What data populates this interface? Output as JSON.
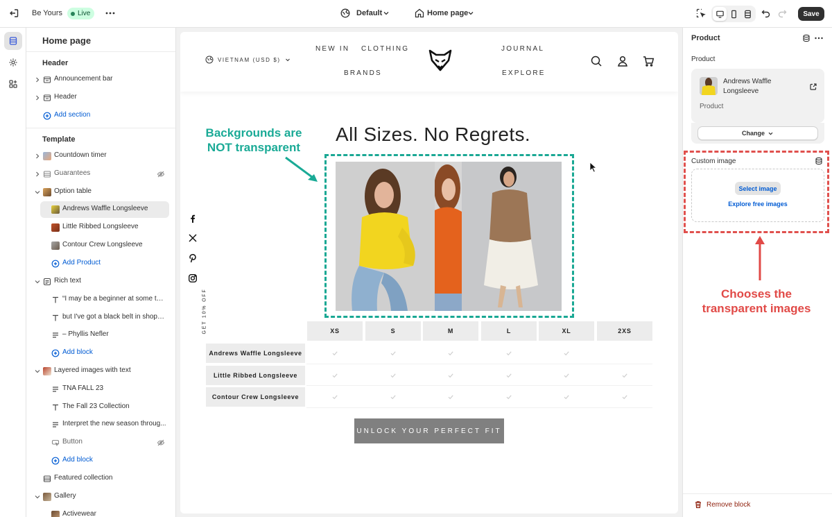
{
  "topbar": {
    "store_name": "Be Yours",
    "status": "Live",
    "theme_selector": "Default",
    "page_selector": "Home page",
    "save_label": "Save"
  },
  "left_panel": {
    "title": "Home page",
    "header_group": "Header",
    "header_items": [
      "Announcement bar",
      "Header"
    ],
    "add_section": "Add section",
    "template_group": "Template",
    "template_items": {
      "countdown": "Countdown timer",
      "guarantees": "Guarantees",
      "option_table": "Option table",
      "product_1": "Andrews Waffle Longsleeve",
      "product_2": "Little Ribbed Longsleeve",
      "product_3": "Contour Crew Longsleeve",
      "add_product": "Add Product",
      "rich_text": "Rich text",
      "rt_1": "“I may be a beginner at some thi...",
      "rt_2": "but I've got a black belt in shoppi...",
      "rt_3": "– Phyllis Nefler",
      "add_block_1": "Add block",
      "layered": "Layered images with text",
      "li_1": "TNA FALL 23",
      "li_2": "The Fall 23 Collection",
      "li_3": "Interpret the new season throug...",
      "li_4": "Button",
      "add_block_2": "Add block",
      "featured": "Featured collection",
      "gallery": "Gallery",
      "gallery_1": "Activewear"
    }
  },
  "storefront": {
    "locale": "VIETNAM (USD $)",
    "nav": [
      "NEW IN",
      "CLOTHING",
      "BRANDS",
      "JOURNAL",
      "EXPLORE"
    ],
    "section_title": "All Sizes. No Regrets.",
    "promo_vertical": "GET 10% OFF",
    "sizes": [
      "XS",
      "S",
      "M",
      "L",
      "XL",
      "2XS"
    ],
    "rows": [
      {
        "name": "Andrews Waffle Longsleeve",
        "checks": [
          1,
          1,
          1,
          1,
          1,
          0
        ]
      },
      {
        "name": "Little Ribbed Longsleeve",
        "checks": [
          1,
          1,
          1,
          1,
          1,
          1
        ]
      },
      {
        "name": "Contour Crew Longsleeve",
        "checks": [
          1,
          1,
          1,
          1,
          1,
          1
        ]
      }
    ],
    "cta": "UNLOCK YOUR PERFECT FIT"
  },
  "annotations": {
    "green_line1": "Backgrounds are",
    "green_line2": "NOT transparent",
    "red_line1": "Chooses the",
    "red_line2": "transparent images",
    "green_color": "#1aa894",
    "red_color": "#e0504d"
  },
  "right_panel": {
    "title": "Product",
    "product_label": "Product",
    "product_name": "Andrews Waffle Longsleeve",
    "product_type": "Product",
    "change_label": "Change",
    "custom_image_label": "Custom image",
    "select_image": "Select image",
    "explore_images": "Explore free images",
    "remove_block": "Remove block"
  }
}
